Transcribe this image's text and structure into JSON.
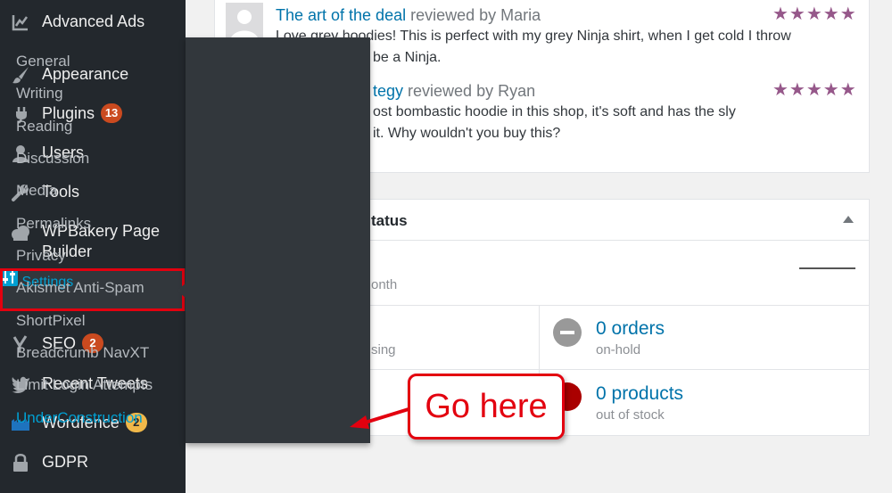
{
  "sidebar": {
    "advanced_ads": "Advanced Ads",
    "appearance": "Appearance",
    "plugins": "Plugins",
    "plugins_badge": "13",
    "users": "Users",
    "tools": "Tools",
    "wpbakery_line1": "WPBakery Page",
    "wpbakery_line2": "Builder",
    "settings": "Settings",
    "seo": "SEO",
    "seo_badge": "2",
    "recent_tweets": "Recent Tweets",
    "wordfence": "Wordfence",
    "wordfence_badge": "2",
    "gdpr": "GDPR"
  },
  "submenu": {
    "items": [
      "General",
      "Writing",
      "Reading",
      "Discussion",
      "Media",
      "Permalinks",
      "Privacy",
      "Akismet Anti-Spam",
      "ShortPixel",
      "Breadcrumb NavXT",
      "Limit Login Attempts",
      "UnderConstruction"
    ]
  },
  "reviews": {
    "r1_link": "The art of the deal",
    "r1_by": " reviewed by Maria",
    "r1_line1": "Love grey hoodies! This is perfect with my grey Ninja shirt, when I get cold I throw",
    "r1_line2": "be a Ninja.",
    "r2_link": "tegy",
    "r2_by": " reviewed by Ryan",
    "r2_line1": "ost bombastic hoodie in this shop, it's soft and has the sly",
    "r2_line2": "it. Why wouldn't you buy this?",
    "stars": "★★★★★"
  },
  "status": {
    "heading_partial": "tatus",
    "month_partial": "onth",
    "sing_partial": "sing",
    "orders_link": "0 orders",
    "orders_sub": "on-hold",
    "products_link": "0 products",
    "products_sub": "out of stock"
  },
  "callout": {
    "text": "Go here"
  },
  "colors": {
    "sidebar_bg": "#23282d",
    "submenu_bg": "#32373c",
    "accent_blue": "#00a0d2",
    "link_blue": "#0073aa",
    "badge_red": "#ca4a1f",
    "badge_orange": "#f0b849",
    "highlight_red": "#e3000f",
    "star_purple": "#96588a"
  }
}
